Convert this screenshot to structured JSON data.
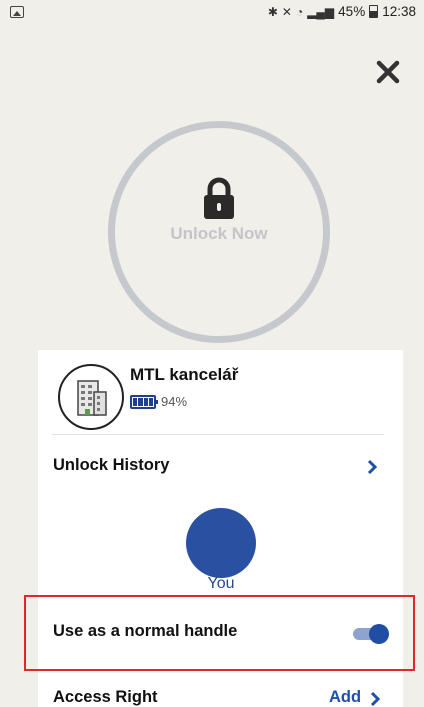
{
  "status_bar": {
    "icons": [
      "image-icon",
      "bluetooth-icon",
      "mute-icon",
      "wifi-icon",
      "signal-icon"
    ],
    "battery_percent": "45%",
    "time": "12:38"
  },
  "lock": {
    "button_label": "Unlock Now",
    "ring_color": "#c5c8cd"
  },
  "device": {
    "name": "MTL kancelář",
    "battery": "94%",
    "battery_level": 0.94,
    "icon": "building-icon"
  },
  "history": {
    "title": "Unlock History",
    "users": [
      {
        "label": "You",
        "color": "#2a51a1"
      }
    ]
  },
  "handle": {
    "label": "Use as a normal handle",
    "enabled": true
  },
  "access": {
    "title": "Access Right",
    "add_label": "Add"
  },
  "colors": {
    "accent": "#2050a8",
    "highlight": "#e0262f",
    "background": "#f1efea"
  }
}
